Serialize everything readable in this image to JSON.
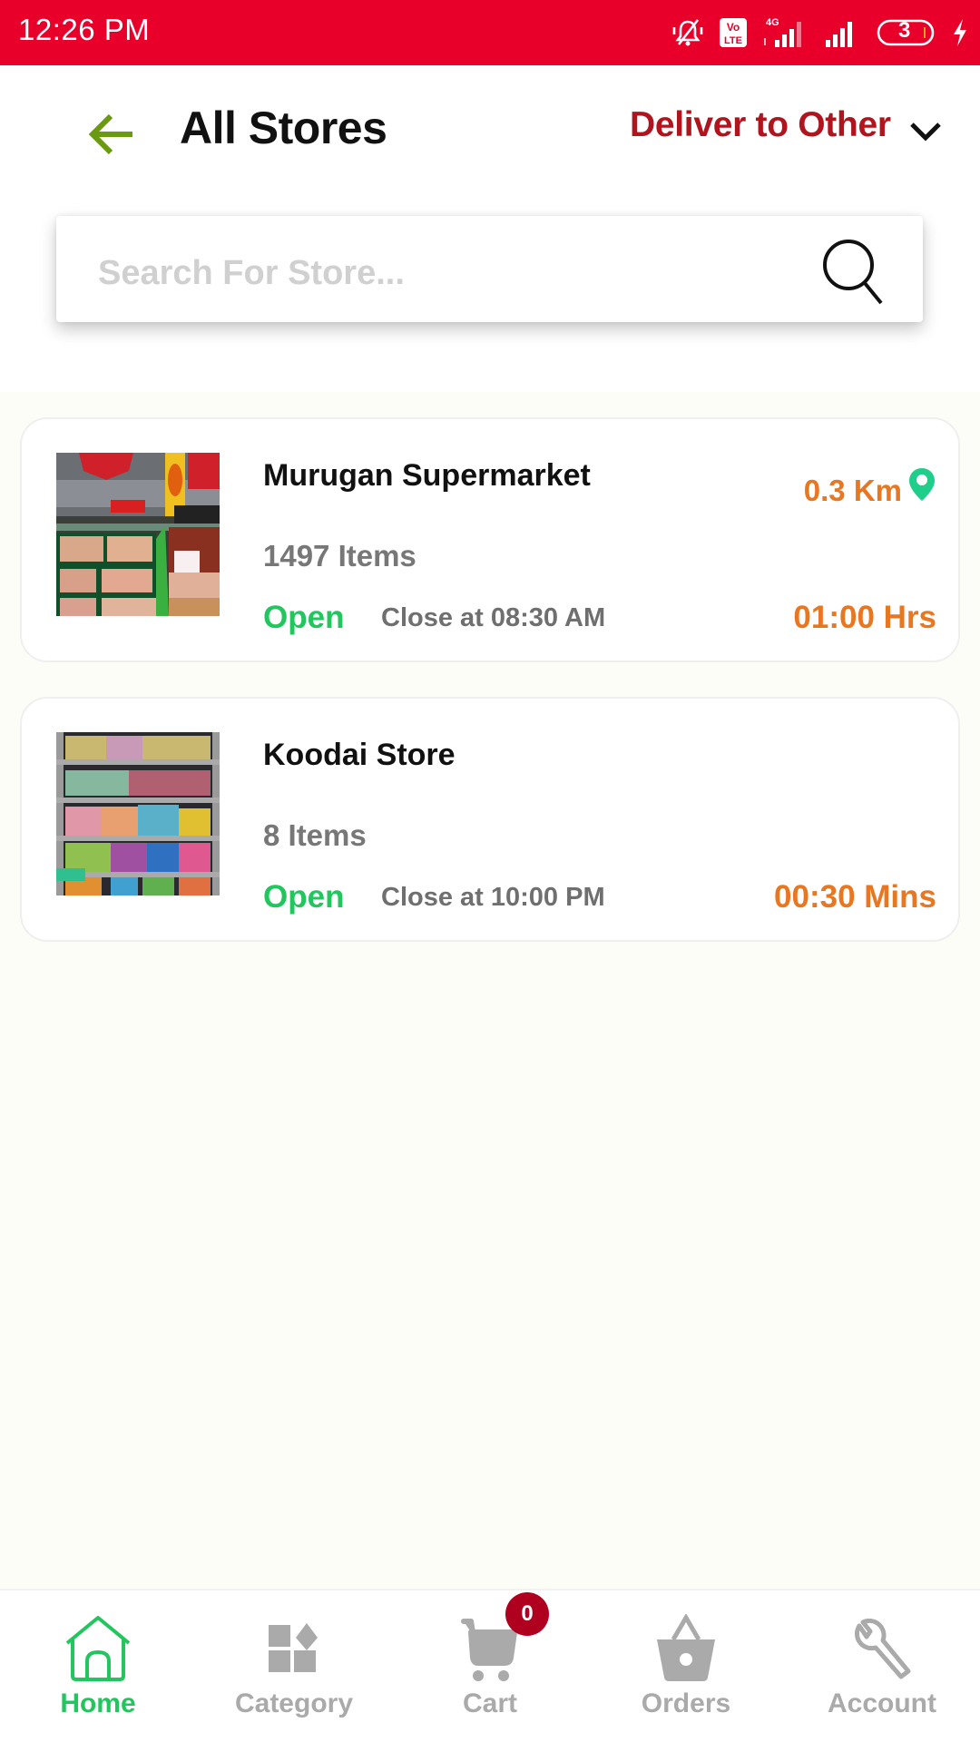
{
  "status_bar": {
    "time": "12:26 PM",
    "battery_level": "3",
    "network_label": "4G",
    "volte_label": "Vo LTE"
  },
  "header": {
    "title": "All Stores",
    "deliver_label": "Deliver to Other"
  },
  "search": {
    "placeholder": "Search For Store...",
    "value": ""
  },
  "stores": [
    {
      "name": "Murugan Supermarket",
      "items": "1497 Items",
      "status": "Open",
      "close_time": "Close at 08:30 AM",
      "delivery_time": "01:00 Hrs",
      "distance": "0.3 Km",
      "image": "supermarket-produce-aisle"
    },
    {
      "name": "Koodai Store",
      "items": "8 Items",
      "status": "Open",
      "close_time": "Close at 10:00 PM",
      "delivery_time": "00:30 Mins",
      "distance": "",
      "image": "snack-shelves"
    }
  ],
  "bottom_nav": {
    "items": [
      {
        "label": "Home",
        "icon": "home-icon",
        "active": true
      },
      {
        "label": "Category",
        "icon": "category-icon",
        "active": false
      },
      {
        "label": "Cart",
        "icon": "cart-icon",
        "active": false
      },
      {
        "label": "Orders",
        "icon": "basket-icon",
        "active": false
      },
      {
        "label": "Account",
        "icon": "wrench-icon",
        "active": false
      }
    ],
    "cart_count": "0"
  },
  "colors": {
    "status_bar": "#e8002a",
    "accent_red": "#b0151e",
    "back_arrow": "#6a9a10",
    "open_green": "#22c55e",
    "time_orange": "#e87722",
    "pin_green": "#1fce8a",
    "badge_red": "#b00020",
    "inactive_gray": "#aaaaaa"
  }
}
